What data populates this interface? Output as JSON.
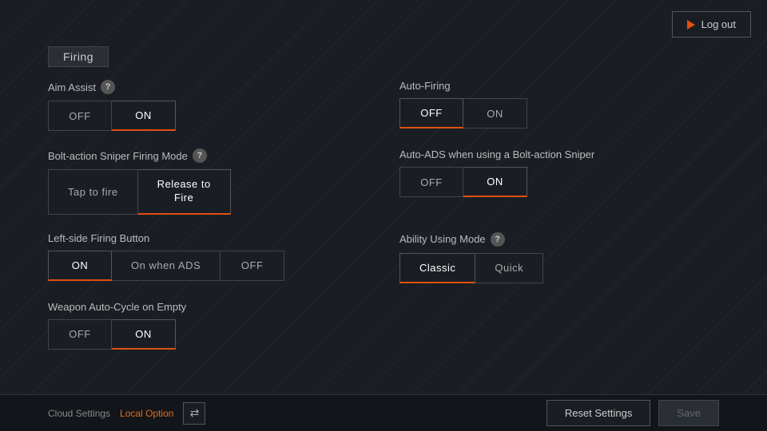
{
  "logout_button": "Log out",
  "section": {
    "title": "Firing"
  },
  "settings": {
    "aim_assist": {
      "label": "Aim Assist",
      "has_help": true,
      "options": [
        "OFF",
        "ON"
      ],
      "active": "ON"
    },
    "auto_firing": {
      "label": "Auto-Firing",
      "has_help": false,
      "options": [
        "OFF",
        "ON"
      ],
      "active": "OFF"
    },
    "bolt_sniper": {
      "label": "Bolt-action Sniper Firing Mode",
      "has_help": true,
      "options": [
        "Tap to fire",
        "Release to Fire"
      ],
      "active": "Release to Fire"
    },
    "auto_ads": {
      "label": "Auto-ADS when using a Bolt-action Sniper",
      "has_help": false,
      "options": [
        "OFF",
        "ON"
      ],
      "active": "ON"
    },
    "left_side_button": {
      "label": "Left-side Firing Button",
      "has_help": false,
      "options": [
        "ON",
        "On when ADS",
        "OFF"
      ],
      "active": "ON"
    },
    "ability_using_mode": {
      "label": "Ability Using Mode",
      "has_help": true,
      "options": [
        "Classic",
        "Quick"
      ],
      "active": "Classic"
    },
    "weapon_auto_cycle": {
      "label": "Weapon Auto-Cycle on Empty",
      "has_help": false,
      "options": [
        "OFF",
        "ON"
      ],
      "active": "ON"
    }
  },
  "bottom": {
    "cloud_settings_label": "Cloud Settings",
    "local_option_label": "Local Option",
    "transfer_icon": "⇄",
    "reset_button": "Reset Settings",
    "save_button": "Save"
  }
}
